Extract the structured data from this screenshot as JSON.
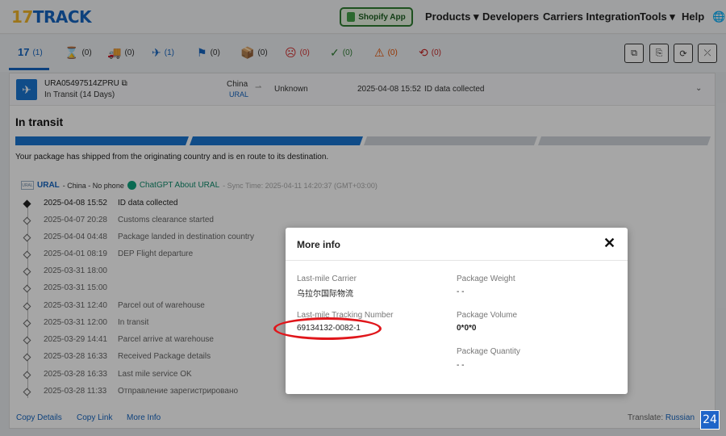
{
  "header": {
    "logo_num": "17",
    "logo_text": "TRACK",
    "shopify": "Shopify App",
    "nav": [
      {
        "label": "Products ▾"
      },
      {
        "label": "Developers"
      },
      {
        "label": "Carriers Integration"
      },
      {
        "label": "Tools ▾"
      },
      {
        "label": "Help"
      },
      {
        "label": "🌐"
      }
    ]
  },
  "tabs": [
    {
      "icon": "17",
      "count": "(1)",
      "color": "#1565c0"
    },
    {
      "icon": "⌛",
      "count": "(0)",
      "color": "#555"
    },
    {
      "icon": "🚚",
      "count": "(0)",
      "color": "#1565c0"
    },
    {
      "icon": "✈",
      "count": "(1)",
      "color": "#1565c0"
    },
    {
      "icon": "⚑",
      "count": "(0)",
      "color": "#1565c0"
    },
    {
      "icon": "📦",
      "count": "(0)",
      "color": "#1565c0"
    },
    {
      "icon": "☹",
      "count": "(0)",
      "color": "#d32f2f"
    },
    {
      "icon": "✓",
      "count": "(0)",
      "color": "#2e7d32"
    },
    {
      "icon": "⚠",
      "count": "(0)",
      "color": "#e65100"
    },
    {
      "icon": "⟲",
      "count": "(0)",
      "color": "#c62828"
    }
  ],
  "tools": [
    "⧉",
    "⎘",
    "⟳",
    "⤫"
  ],
  "summary": {
    "tracking_number": "URA05497514ZPRU ⧉",
    "status": "In Transit (14 Days)",
    "origin": "China",
    "origin_carrier": "URAL",
    "arrow": "⇀",
    "destination": "Unknown",
    "time": "2025-04-08 15:52",
    "event": "ID data collected",
    "expand": "⌄"
  },
  "section_title": "In transit",
  "progress_desc": "Your package has shipped from the originating country and is en route to its destination.",
  "carrier_line": {
    "logo": "URAL",
    "name": "URAL",
    "info": "- China - No phone",
    "gpt": "ChatGPT About URAL",
    "sync": "- Sync Time: 2025-04-11 14:20:37 (GMT+03:00)"
  },
  "events": [
    {
      "time": "2025-04-08 15:52",
      "desc": "ID data collected"
    },
    {
      "time": "2025-04-07 20:28",
      "desc": "Customs clearance started"
    },
    {
      "time": "2025-04-04 04:48",
      "desc": "Package landed in destination country"
    },
    {
      "time": "2025-04-01 08:19",
      "desc": "DEP Flight departure"
    },
    {
      "time": "2025-03-31 18:00",
      "desc": ""
    },
    {
      "time": "2025-03-31 15:00",
      "desc": ""
    },
    {
      "time": "2025-03-31 12:40",
      "desc": "Parcel out of warehouse"
    },
    {
      "time": "2025-03-31 12:00",
      "desc": "In transit"
    },
    {
      "time": "2025-03-29 14:41",
      "desc": "Parcel arrive at warehouse"
    },
    {
      "time": "2025-03-28 16:33",
      "desc": "Received Package details"
    },
    {
      "time": "2025-03-28 16:33",
      "desc": "Last mile service OK"
    },
    {
      "time": "2025-03-28 11:33",
      "desc": "Отправление зарегистрировано"
    }
  ],
  "footer": {
    "copy_details": "Copy Details",
    "copy_link": "Copy Link",
    "more_info": "More Info",
    "translate_label": "Translate:",
    "translate_lang": "Russian"
  },
  "modal": {
    "title": "More info",
    "close": "✕",
    "last_mile_carrier_label": "Last-mile Carrier",
    "last_mile_carrier_value": "乌拉尔国际物流",
    "last_mile_tracking_label": "Last-mile Tracking Number",
    "last_mile_tracking_value": "69134132-0082-1",
    "weight_label": "Package Weight",
    "weight_value": "- -",
    "volume_label": "Package Volume",
    "volume_value": "0*0*0",
    "quantity_label": "Package Quantity",
    "quantity_value": "- -"
  },
  "badge": "24"
}
